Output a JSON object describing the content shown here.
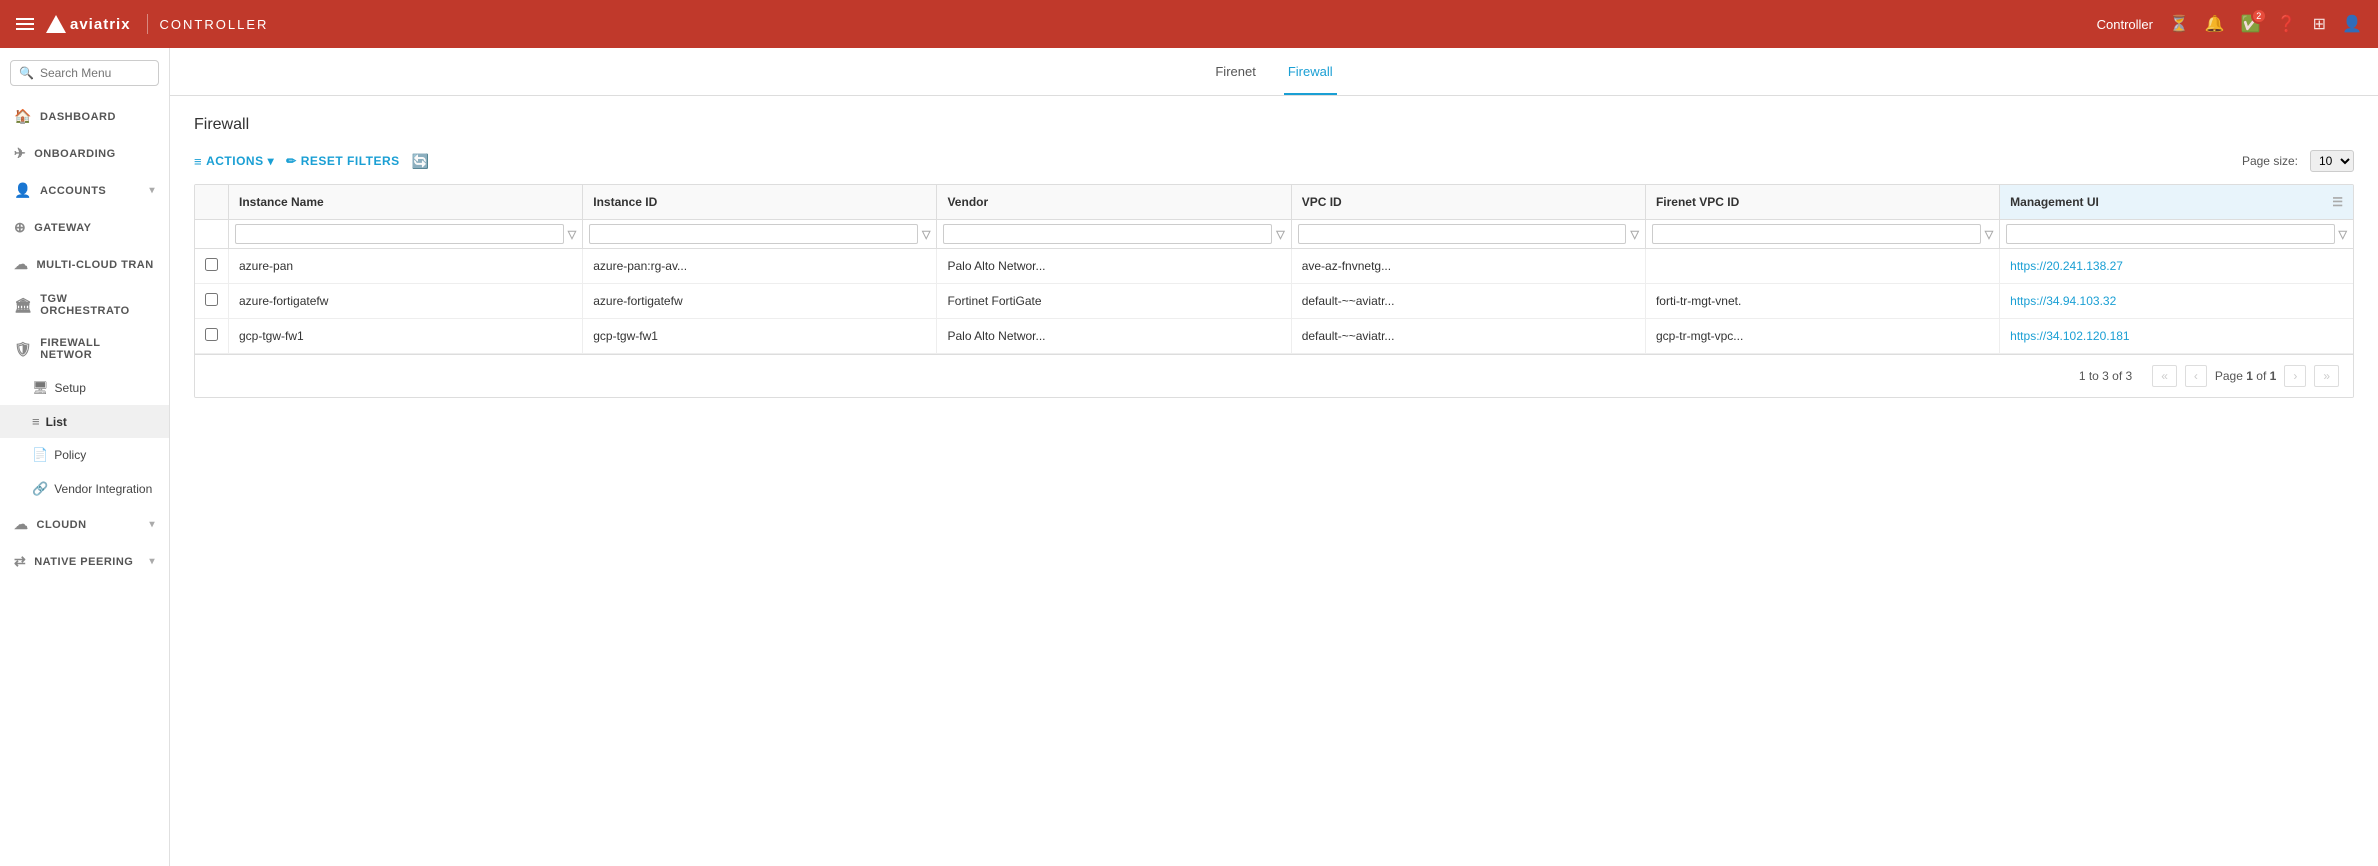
{
  "topnav": {
    "brand": "aviatrix",
    "controller_label": "Controller",
    "right_label": "Controller",
    "badge_count": "2"
  },
  "sidebar": {
    "search_placeholder": "Search Menu",
    "nav_items": [
      {
        "id": "dashboard",
        "label": "Dashboard",
        "icon": "🏠",
        "has_sub": false
      },
      {
        "id": "onboarding",
        "label": "Onboarding",
        "icon": "✈",
        "has_sub": false
      },
      {
        "id": "accounts",
        "label": "Accounts",
        "icon": "👤",
        "has_sub": true
      },
      {
        "id": "gateway",
        "label": "Gateway",
        "icon": "⊕",
        "has_sub": false
      },
      {
        "id": "multi-cloud",
        "label": "Multi-Cloud Tran",
        "icon": "☁",
        "has_sub": false
      },
      {
        "id": "tgw",
        "label": "TGW Orchestrato",
        "icon": "🏛",
        "has_sub": false
      },
      {
        "id": "firewall",
        "label": "Firewall Networ",
        "icon": "🛡",
        "has_sub": false
      }
    ],
    "firewall_sub": [
      {
        "id": "setup",
        "label": "Setup",
        "icon": "🖥"
      },
      {
        "id": "list",
        "label": "List",
        "icon": "≡",
        "active": true
      },
      {
        "id": "policy",
        "label": "Policy",
        "icon": "📄"
      },
      {
        "id": "vendor-integration",
        "label": "Vendor Integration",
        "icon": "🔗"
      }
    ],
    "bottom_items": [
      {
        "id": "cloudn",
        "label": "CloudN",
        "icon": "☁",
        "has_sub": true
      },
      {
        "id": "native-peering",
        "label": "Native Peering",
        "icon": "⇄",
        "has_sub": true
      }
    ]
  },
  "tabs": [
    {
      "id": "firenet",
      "label": "Firenet",
      "active": false
    },
    {
      "id": "firewall",
      "label": "Firewall",
      "active": true
    }
  ],
  "page": {
    "title": "Firewall"
  },
  "toolbar": {
    "actions_label": "ACTIONS",
    "reset_label": "RESET FILTERS",
    "page_size_label": "Page size:",
    "page_size_value": "10"
  },
  "table": {
    "columns": [
      {
        "id": "instance-name",
        "label": "Instance Name"
      },
      {
        "id": "instance-id",
        "label": "Instance ID"
      },
      {
        "id": "vendor",
        "label": "Vendor"
      },
      {
        "id": "vpc-id",
        "label": "VPC ID"
      },
      {
        "id": "firenet-vpc-id",
        "label": "Firenet VPC ID"
      },
      {
        "id": "management-ui",
        "label": "Management UI"
      }
    ],
    "rows": [
      {
        "checked": false,
        "instance_name": "azure-pan",
        "instance_id": "azure-pan:rg-av...",
        "vendor": "Palo Alto Networ...",
        "vpc_id": "ave-az-fnvnetg...",
        "firenet_vpc_id": "",
        "management_ui": "https://20.241.138.27"
      },
      {
        "checked": false,
        "instance_name": "azure-fortigatefw",
        "instance_id": "azure-fortigatefw",
        "vendor": "Fortinet FortiGate",
        "vpc_id": "default-~~aviatr...",
        "firenet_vpc_id": "forti-tr-mgt-vnet.",
        "management_ui": "https://34.94.103.32"
      },
      {
        "checked": false,
        "instance_name": "gcp-tgw-fw1",
        "instance_id": "gcp-tgw-fw1",
        "vendor": "Palo Alto Networ...",
        "vpc_id": "default-~~aviatr...",
        "firenet_vpc_id": "gcp-tr-mgt-vpc...",
        "management_ui": "https://34.102.120.181"
      }
    ]
  },
  "pagination": {
    "info": "1 to 3 of 3",
    "page_label": "Page",
    "current_page": "1",
    "total_pages": "1"
  }
}
